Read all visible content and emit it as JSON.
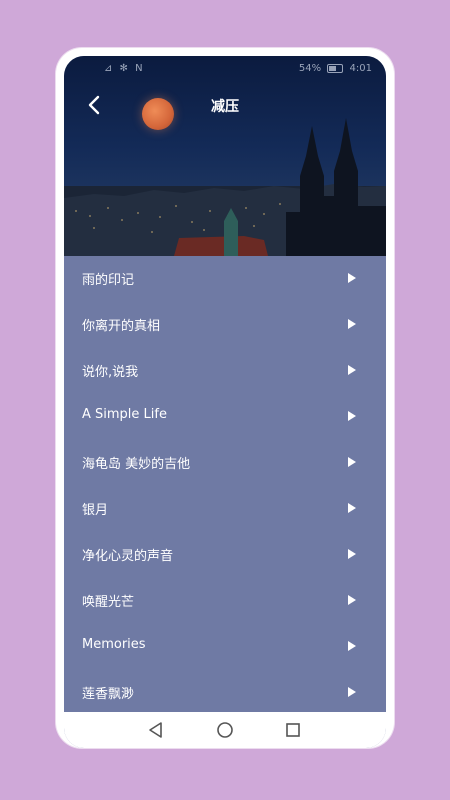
{
  "status_bar": {
    "left_icons": "⊿ ✻ N",
    "battery_percent": "54%",
    "time": "4:01"
  },
  "header": {
    "title": "减压"
  },
  "tracks": [
    {
      "label": "雨的印记"
    },
    {
      "label": "你离开的真相"
    },
    {
      "label": "说你,说我"
    },
    {
      "label": "A Simple Life"
    },
    {
      "label": "海龟岛 美妙的吉他"
    },
    {
      "label": "银月"
    },
    {
      "label": "净化心灵的声音"
    },
    {
      "label": "唤醒光芒"
    },
    {
      "label": "Memories"
    },
    {
      "label": "莲香飘渺"
    }
  ],
  "colors": {
    "background": "#cfa8d8",
    "list_background": "#6f7aa4",
    "header_dark": "#0b1b3f"
  }
}
